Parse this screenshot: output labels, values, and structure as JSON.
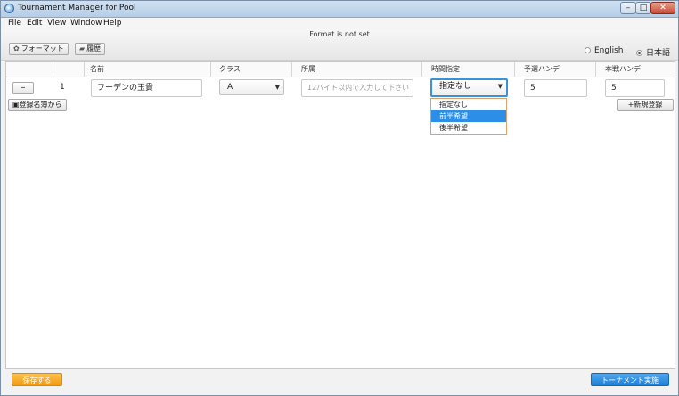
{
  "window": {
    "title": "Tournament Manager for Pool",
    "minimize": "–",
    "maximize": "□",
    "close": "✕"
  },
  "menu": [
    "File",
    "Edit",
    "View",
    "Window",
    "Help"
  ],
  "toolbar": {
    "status": "Format is not set",
    "format_label": "フォーマット",
    "history_label": "履歴",
    "lang_english": "English",
    "lang_japanese": "日本語",
    "selected_language": "日本語"
  },
  "table": {
    "headers": [
      "",
      "",
      "名前",
      "クラス",
      "所属",
      "時間指定",
      "予選ハンデ",
      "本戦ハンデ"
    ],
    "row": {
      "remove_label": "–",
      "number": "1",
      "name": "フーデンの玉貴",
      "class": "A",
      "affiliation_placeholder": "12バイト以内で入力して下さい",
      "time": "指定なし",
      "prelim_handicap": "5",
      "final_handicap": "5"
    }
  },
  "registry_button": "登録名簿から",
  "new_button": "+新規登録",
  "time_dropdown": {
    "options": [
      "指定なし",
      "前半希望",
      "後半希望"
    ],
    "highlighted": "前半希望"
  },
  "footer": {
    "save_label": "保存する",
    "run_label": "トーナメント実施"
  },
  "colors": {
    "accent": "#2c8ee6",
    "save": "#f29a12",
    "run": "#1f7fd6"
  }
}
